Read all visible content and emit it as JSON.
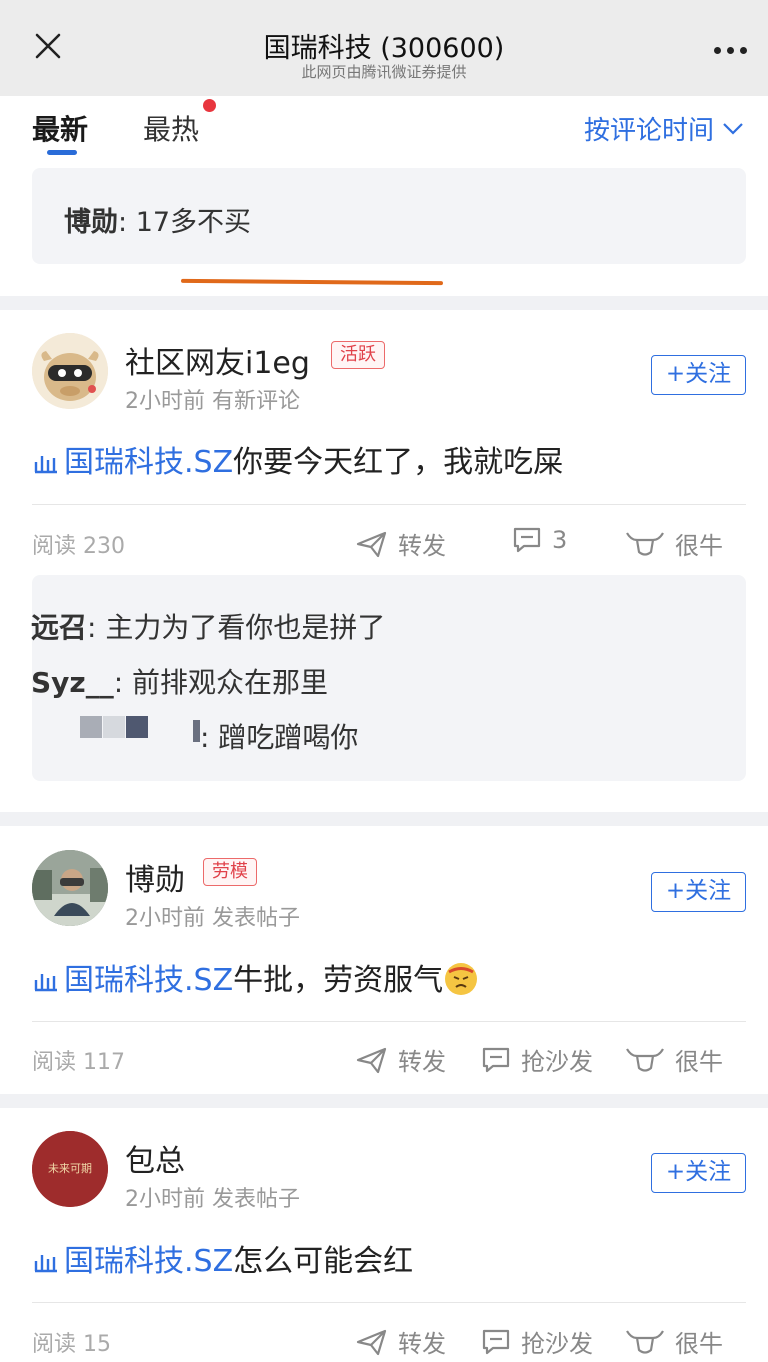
{
  "header": {
    "title": "国瑞科技 (300600)",
    "subtitle": "此网页由腾讯微证券提供",
    "close_icon": "close-icon",
    "more_icon": "more-icon"
  },
  "tabs": [
    {
      "label": "最新",
      "active": true
    },
    {
      "label": "最热",
      "active": false,
      "has_dot": true
    }
  ],
  "sort": {
    "label": "按评论时间"
  },
  "quote": {
    "author": "博勋",
    "separator": ": ",
    "text": "17多不买"
  },
  "posts": [
    {
      "username": "社区网友i1eg",
      "badge": "活跃",
      "meta": "2小时前 有新评论",
      "follow_label": "+关注",
      "stock_link": "国瑞科技.SZ",
      "content": "你要今天红了，我就吃屎",
      "read_label": "阅读 230",
      "forward_label": "转发",
      "comment_label": "3",
      "like_label": "很牛",
      "replies": [
        {
          "author": "远召",
          "text": ": 主力为了看你也是拼了"
        },
        {
          "author": "Syz__",
          "text": ": 前排观众在那里"
        },
        {
          "author": "",
          "text": ": 蹭吃蹭喝你"
        }
      ]
    },
    {
      "username": "博勋",
      "badge": "劳模",
      "meta": "2小时前 发表帖子",
      "follow_label": "+关注",
      "stock_link": "国瑞科技.SZ",
      "content": "牛批，劳资服气",
      "read_label": "阅读 117",
      "forward_label": "转发",
      "comment_label": "抢沙发",
      "like_label": "很牛"
    },
    {
      "username": "包总",
      "meta": "2小时前 发表帖子",
      "follow_label": "+关注",
      "stock_link": "国瑞科技.SZ",
      "content": "怎么可能会红",
      "read_label": "阅读 15",
      "forward_label": "转发",
      "comment_label": "抢沙发",
      "like_label": "很牛",
      "avatar_text": "未来可期"
    }
  ],
  "colors": {
    "accent": "#2f6fe0",
    "badge_red": "#e0424a",
    "underline_orange": "#e0691a",
    "background": "#f0f1f4"
  }
}
